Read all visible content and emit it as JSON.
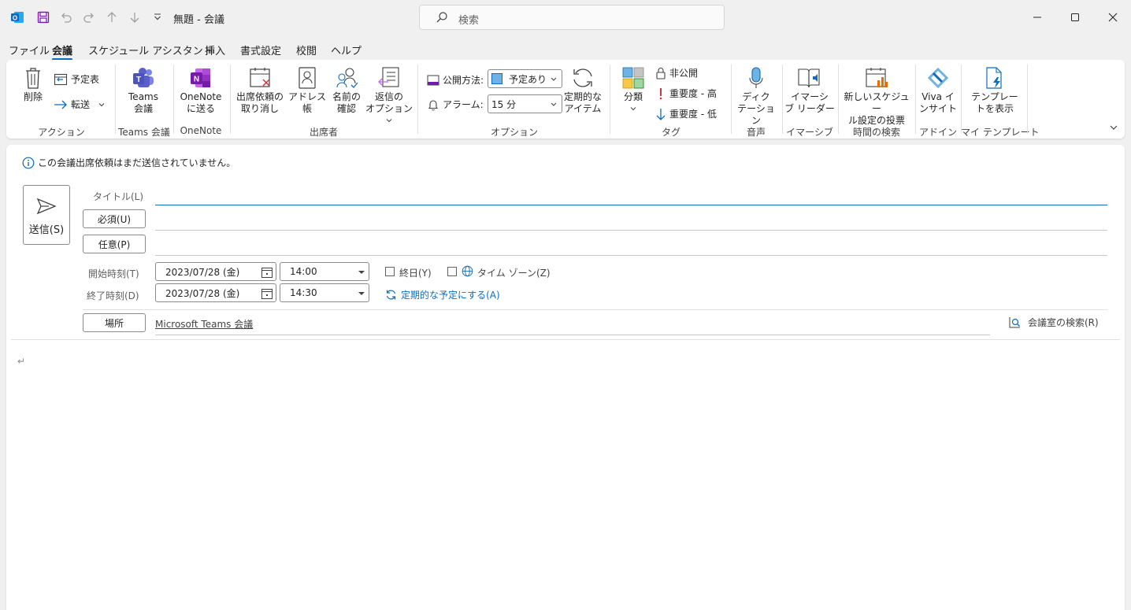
{
  "window": {
    "title": "無題 - 会議",
    "search_placeholder": "検索"
  },
  "menu": {
    "tabs": [
      "ファイル",
      "会議",
      "スケジュール アシスタント",
      "挿入",
      "書式設定",
      "校閲",
      "ヘルプ"
    ],
    "active": "会議"
  },
  "ribbon": {
    "delete_label": "削除",
    "calendar_label": "予定表",
    "forward_label": "転送",
    "group_action": "アクション",
    "teams_label_1": "Teams",
    "teams_label_2": "会議",
    "group_teams": "Teams 会議",
    "onenote_label_1": "OneNote",
    "onenote_label_2": "に送る",
    "group_onenote": "OneNote",
    "cancel_invite_1": "出席依頼の",
    "cancel_invite_2": "取り消し",
    "address_book": "アドレス帳",
    "check_names_1": "名前の",
    "check_names_2": "確認",
    "response_options_1": "返信の",
    "response_options_2": "オプション",
    "group_attendees": "出席者",
    "show_as_label": "公開方法:",
    "show_as_value": "予定あり",
    "reminder_label": "アラーム:",
    "reminder_value": "15 分",
    "recurring_1": "定期的な",
    "recurring_2": "アイテム",
    "group_options": "オプション",
    "categorize": "分類",
    "private": "非公開",
    "high_importance": "重要度 - 高",
    "low_importance": "重要度 - 低",
    "group_tags": "タグ",
    "dictate_1": "ディク",
    "dictate_2": "テーション",
    "group_voice": "音声",
    "immersive_1": "イマーシ",
    "immersive_2": "ブ リーダー",
    "group_immersive": "イマーシブ",
    "new_poll_1": "新しいスケジュー",
    "new_poll_2": "ル設定の投票",
    "group_find_time": "時間の検索",
    "viva_1": "Viva イ",
    "viva_2": "ンサイト",
    "group_addin": "アドイン",
    "templates_1": "テンプレー",
    "templates_2": "トを表示",
    "group_my_templates": "マイ テンプレート"
  },
  "form": {
    "info_text": "この会議出席依頼はまだ送信されていません。",
    "send_label": "送信(S)",
    "title_label": "タイトル(L)",
    "required_label": "必須(U)",
    "optional_label": "任意(P)",
    "start_label": "開始時刻(T)",
    "end_label": "終了時刻(D)",
    "start_date": "2023/07/28 (金)",
    "start_time": "14:00",
    "end_date": "2023/07/28 (金)",
    "end_time": "14:30",
    "all_day_label": "終日(Y)",
    "time_zone_label": "タイム ゾーン(Z)",
    "make_recurring_label": "定期的な予定にする(A)",
    "location_button": "場所",
    "location_value": "Microsoft Teams 会議",
    "room_finder_label": "会議室の検索(R)",
    "body_mark": "↵"
  },
  "colors": {
    "accent": "#0f6cbd",
    "teams": "#5b5fc7",
    "onenote": "#7719aa",
    "outlook": "#0f6cbd",
    "high_importance": "#d13438",
    "low_importance": "#0f6cbd"
  }
}
